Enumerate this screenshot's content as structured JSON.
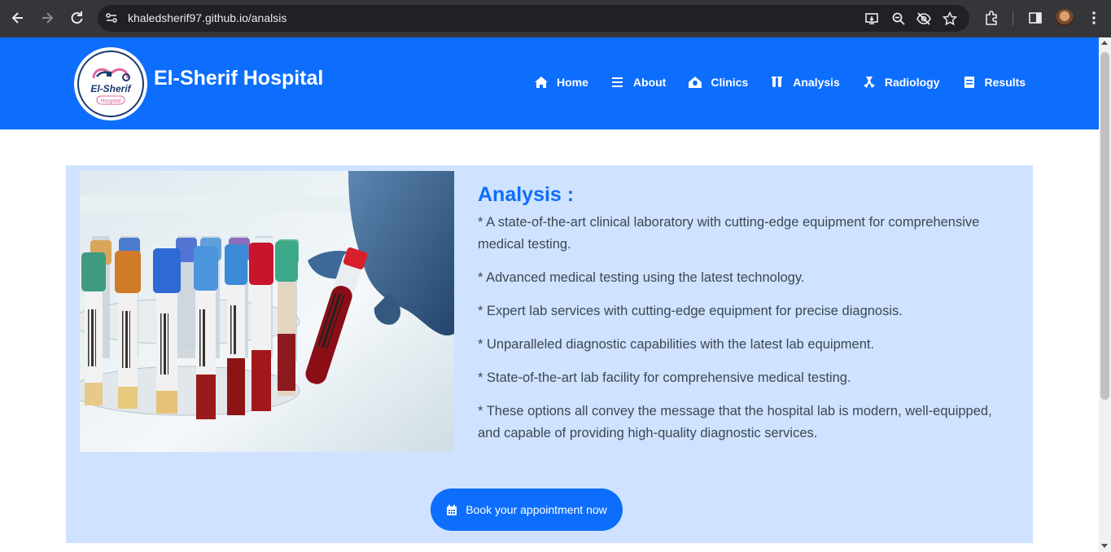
{
  "browser": {
    "url": "khaledsherif97.github.io/analsis",
    "icons": [
      "back-arrow-icon",
      "forward-arrow-icon",
      "reload-icon",
      "site-settings-icon",
      "install-app-icon",
      "zoom-icon",
      "eye-off-icon",
      "star-icon",
      "extensions-icon",
      "side-panel-icon",
      "profile-avatar",
      "kebab-menu-icon"
    ]
  },
  "header": {
    "logo_text": "El-Sherif",
    "logo_subtext": "Hospital",
    "brand": "El-Sherif Hospital",
    "nav": [
      {
        "label": "Home",
        "icon": "home-icon"
      },
      {
        "label": "About",
        "icon": "bars-icon"
      },
      {
        "label": "Clinics",
        "icon": "clinic-icon"
      },
      {
        "label": "Analysis",
        "icon": "test-tubes-icon"
      },
      {
        "label": "Radiology",
        "icon": "radiation-icon"
      },
      {
        "label": "Results",
        "icon": "file-icon"
      }
    ]
  },
  "analysis": {
    "title": "Analysis :",
    "points": [
      "* A state-of-the-art clinical laboratory with cutting-edge equipment for comprehensive medical testing.",
      "* Advanced medical testing using the latest technology.",
      "* Expert lab services with cutting-edge equipment for precise diagnosis.",
      "* Unparalleled diagnostic capabilities with the latest lab equipment.",
      "* State-of-the-art lab facility for comprehensive medical testing.",
      "* These options all convey the message that the hospital lab is modern, well-equipped, and capable of providing high-quality diagnostic services."
    ],
    "button_label": "Book your appointment now"
  },
  "colors": {
    "primary": "#0d6efd",
    "card_bg": "#cfe2ff",
    "chrome_bg": "#35363a",
    "omnibox_bg": "#202124"
  }
}
